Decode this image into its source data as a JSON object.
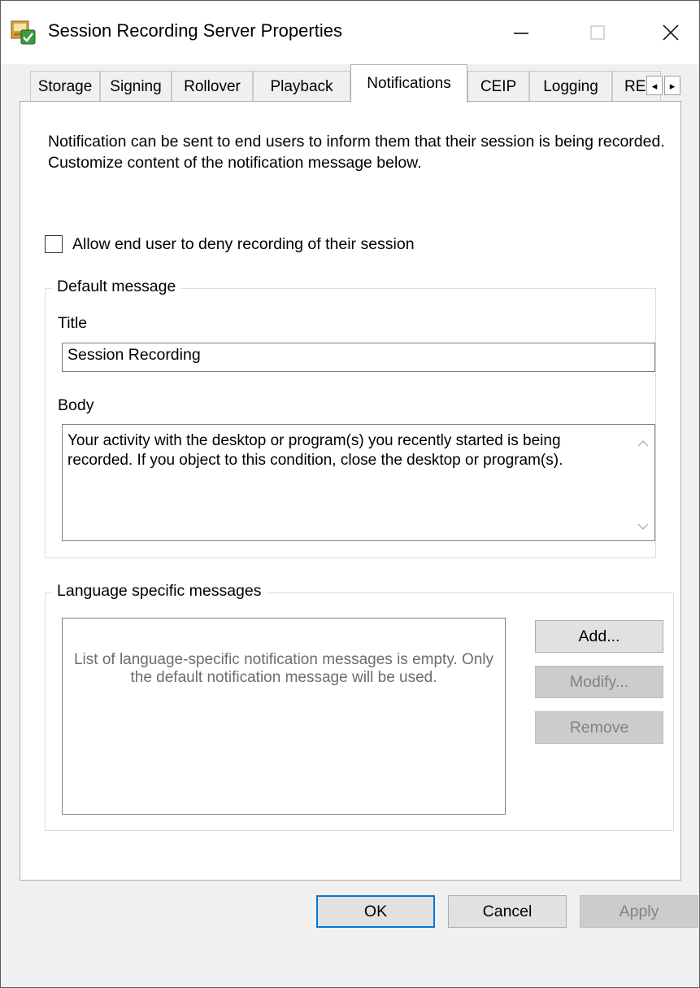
{
  "window": {
    "title": "Session Recording Server Properties",
    "icon": "session-recording-server-icon",
    "controls": {
      "minimize": "minimize-icon",
      "maximize": "maximize-icon",
      "close": "close-icon"
    }
  },
  "tabs": [
    {
      "label": "Storage"
    },
    {
      "label": "Signing"
    },
    {
      "label": "Rollover"
    },
    {
      "label": "Playback"
    },
    {
      "label": "Notifications",
      "active": true
    },
    {
      "label": "CEIP"
    },
    {
      "label": "Logging"
    },
    {
      "label": "RE"
    }
  ],
  "tab_scroll": {
    "left": "◂",
    "right": "▸"
  },
  "notifications": {
    "intro": "Notification can be sent to end users to inform them that their session is being recorded. Customize content of the notification message below.",
    "allow_deny_label": "Allow end user to deny recording of their session",
    "allow_deny_checked": false,
    "default_message": {
      "legend": "Default message",
      "title_label": "Title",
      "title_value": "Session Recording",
      "body_label": "Body",
      "body_value": "Your activity with the desktop or program(s) you recently started is being recorded. If you object to this condition, close the desktop or program(s)."
    },
    "language_messages": {
      "legend": "Language specific messages",
      "empty_text": "List of language-specific notification messages is empty. Only the default notification message will be used.",
      "add_label": "Add...",
      "modify_label": "Modify...",
      "remove_label": "Remove"
    }
  },
  "footer": {
    "ok_label": "OK",
    "cancel_label": "Cancel",
    "apply_label": "Apply"
  },
  "colors": {
    "focus_border": "#0078d7",
    "disabled_text": "#838383",
    "dialog_background": "#f0f0f0"
  }
}
